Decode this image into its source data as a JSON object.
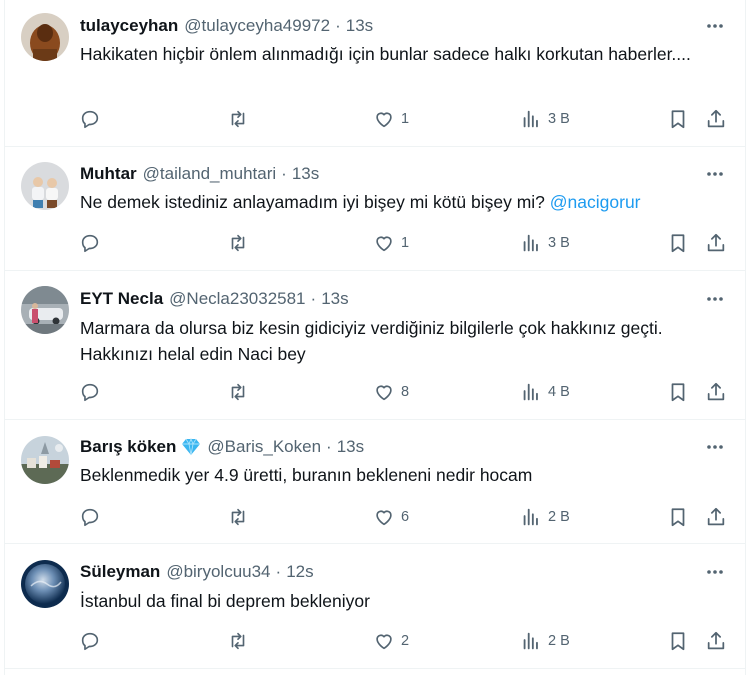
{
  "tweets": [
    {
      "name": "tulayceyhan",
      "handle": "@tulayceyha49972",
      "separator": "·",
      "time": "13s",
      "text": "Hakikaten hiçbir önlem alınmadığı için bunlar sadece halkı korkutan haberler....",
      "mention": "",
      "likes": "1",
      "views": "3 B",
      "avatar_colors": [
        "#d8cfc3",
        "#8a4a1e"
      ]
    },
    {
      "name": "Muhtar",
      "handle": "@tailand_muhtari",
      "separator": "·",
      "time": "13s",
      "text": "Ne demek istediniz anlayamadım iyi bişey mi kötü bişey mi?",
      "mention": "@nacigorur",
      "likes": "1",
      "views": "3 B",
      "avatar_colors": [
        "#d9dbde",
        "#3f7fb0"
      ]
    },
    {
      "name": "EYT Necla",
      "handle": "@Necla23032581",
      "separator": "·",
      "time": "13s",
      "text": "Marmara da olursa biz kesin gidiciyiz verdiğiniz bilgilerle çok hakkınız geçti. Hakkınızı helal edin Naci bey",
      "mention": "",
      "likes": "8",
      "views": "4 B",
      "avatar_colors": [
        "#a8b0b6",
        "#e9ecef"
      ]
    },
    {
      "name": "Barış köken",
      "handle": "@Baris_Koken",
      "separator": "·",
      "time": "13s",
      "text": "Beklenmedik yer 4.9 üretti, buranın bekleneni nedir hocam",
      "mention": "",
      "likes": "6",
      "views": "2 B",
      "avatar_colors": [
        "#c7d3dc",
        "#5d6a55"
      ]
    },
    {
      "name": "Süleyman",
      "handle": "@biryolcuu34",
      "separator": "·",
      "time": "12s",
      "text": "İstanbul da final bi deprem bekleniyor",
      "mention": "",
      "likes": "2",
      "views": "2 B",
      "avatar_colors": [
        "#0d2b4e",
        "#9fb8d6"
      ]
    }
  ],
  "icons": {
    "more": "more-icon",
    "reply": "reply-icon",
    "retweet": "retweet-icon",
    "like": "heart-icon",
    "views": "views-icon",
    "bookmark": "bookmark-icon",
    "share": "share-icon",
    "badge": "diamond-icon"
  },
  "colors": {
    "text": "#0f1419",
    "secondary": "#536471",
    "link": "#1d9bf0",
    "divider": "#eff3f4",
    "badge": "#1d9bf0"
  }
}
